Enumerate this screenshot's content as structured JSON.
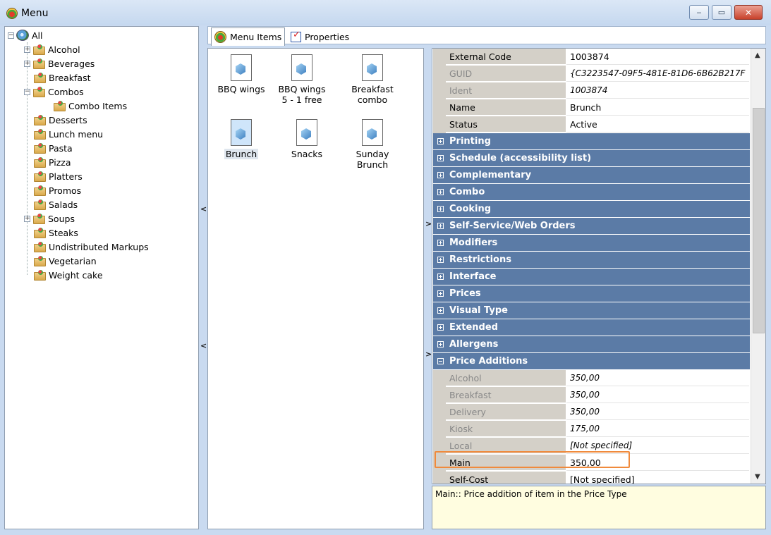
{
  "window": {
    "title": "Menu",
    "minimize": "‒",
    "maximize": "▭",
    "close": "✕"
  },
  "tree": {
    "root": "All",
    "items": [
      {
        "label": "Alcohol",
        "expander": "+"
      },
      {
        "label": "Beverages",
        "expander": "+"
      },
      {
        "label": "Breakfast",
        "expander": ""
      },
      {
        "label": "Combos",
        "expander": "−"
      },
      {
        "label": "Combo Items",
        "expander": ""
      },
      {
        "label": "Desserts",
        "expander": ""
      },
      {
        "label": "Lunch menu",
        "expander": ""
      },
      {
        "label": "Pasta",
        "expander": ""
      },
      {
        "label": "Pizza",
        "expander": ""
      },
      {
        "label": "Platters",
        "expander": ""
      },
      {
        "label": "Promos",
        "expander": ""
      },
      {
        "label": "Salads",
        "expander": ""
      },
      {
        "label": "Soups",
        "expander": "+"
      },
      {
        "label": "Steaks",
        "expander": ""
      },
      {
        "label": "Undistributed Markups",
        "expander": ""
      },
      {
        "label": "Vegetarian",
        "expander": ""
      },
      {
        "label": "Weight cake",
        "expander": ""
      }
    ]
  },
  "tabs": [
    {
      "label": "Menu Items",
      "active": true
    },
    {
      "label": "Properties",
      "active": false
    }
  ],
  "menu_items": [
    {
      "label": "BBQ wings"
    },
    {
      "label": "BBQ wings 5 - 1 free"
    },
    {
      "label": "Breakfast combo"
    },
    {
      "label": "Brunch",
      "selected": true
    },
    {
      "label": "Snacks"
    },
    {
      "label": "Sunday Brunch"
    }
  ],
  "properties": {
    "top_rows": [
      {
        "key": "External Code",
        "value": "1003874",
        "readonly": false
      },
      {
        "key": "GUID",
        "value": "{C3223547-09F5-481E-81D6-6B62B217F",
        "readonly": true
      },
      {
        "key": "Ident",
        "value": "1003874",
        "readonly": true
      },
      {
        "key": "Name",
        "value": "Brunch",
        "readonly": false
      },
      {
        "key": "Status",
        "value": "Active",
        "readonly": false
      }
    ],
    "categories": [
      "Printing",
      "Schedule (accessibility list)",
      "Complementary",
      "Combo",
      "Cooking",
      "Self-Service/Web Orders",
      "Modifiers",
      "Restrictions",
      "Interface",
      "Prices",
      "Visual Type",
      "Extended",
      "Allergens"
    ],
    "expanded_category": "Price Additions",
    "price_rows": [
      {
        "key": "Alcohol",
        "value": "350,00",
        "readonly": true
      },
      {
        "key": "Breakfast",
        "value": "350,00",
        "readonly": true
      },
      {
        "key": "Delivery",
        "value": "350,00",
        "readonly": true
      },
      {
        "key": "Kiosk",
        "value": "175,00",
        "readonly": true
      },
      {
        "key": "Local",
        "value": "[Not specified]",
        "readonly": true
      },
      {
        "key": "Main",
        "value": "350,00",
        "readonly": false
      },
      {
        "key": "Self-Cost",
        "value": "[Not specified]",
        "readonly": false
      }
    ]
  },
  "help_text": "Main:: Price addition of item in the Price Type",
  "splitter_glyphs": {
    "left": "<",
    "right": ">"
  },
  "colors": {
    "category_bg": "#5b7ba6",
    "highlight": "#f08a3c",
    "help_bg": "#fffde0"
  }
}
